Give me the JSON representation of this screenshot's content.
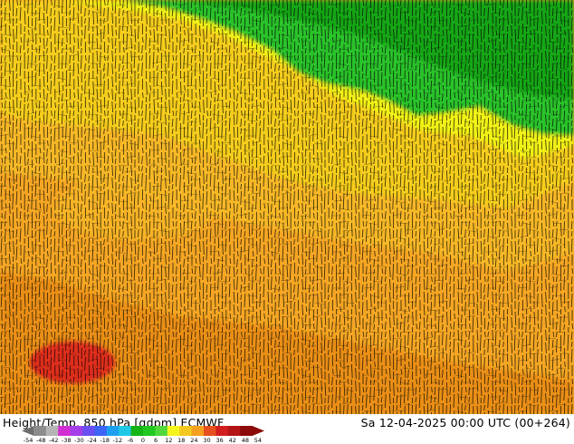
{
  "map": {
    "field_colors": {
      "green_dark": "#19a619",
      "green": "#2cc32c",
      "yellow": "#f2f218",
      "yellow_orange": "#f5cd1f",
      "orange_light": "#f7b828",
      "orange": "#f5a623",
      "orange_dark": "#ea8f17",
      "red": "#dc1e1e"
    },
    "contour_color": "#000000"
  },
  "footer": {
    "title": "Height/Temp. 850 hPa [gdpm] ECMWF",
    "datetime": "Sa 12-04-2025 00:00 UTC (00+264)"
  },
  "scale": {
    "labels": [
      "-54",
      "-48",
      "-42",
      "-38",
      "-30",
      "-24",
      "-18",
      "-12",
      "-6",
      "0",
      "6",
      "12",
      "18",
      "24",
      "30",
      "36",
      "42",
      "48",
      "54"
    ],
    "colors": [
      "#6e6e6e",
      "#8c8c8c",
      "#b4b4b4",
      "#d22fd2",
      "#a43ee8",
      "#6a4ef0",
      "#3c64f5",
      "#1ea0f0",
      "#1ec8e6",
      "#16b416",
      "#20c820",
      "#50d83c",
      "#f5f51e",
      "#f5c81e",
      "#f5a01e",
      "#e6501e",
      "#d21e1e",
      "#b41414",
      "#8c0a0a"
    ]
  }
}
